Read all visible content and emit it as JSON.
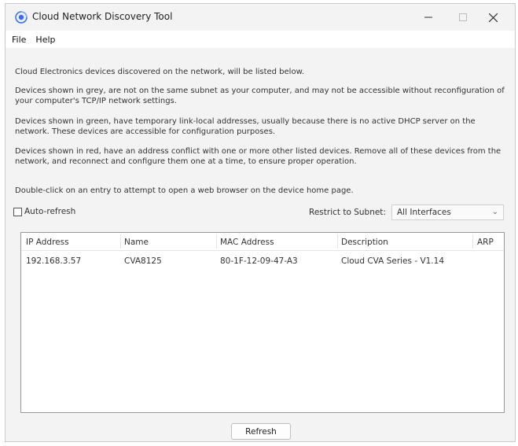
{
  "window": {
    "title": "Cloud Network Discovery Tool"
  },
  "menu": [
    "File",
    "Help"
  ],
  "instructions": [
    "Cloud Electronics devices discovered on the network, will be listed below.",
    "Devices shown in grey, are not on the same subnet as your computer, and may not be accessible without reconfiguration of your computer's TCP/IP network settings.",
    "Devices shown in green, have temporary link-local addresses, usually because there is no active DHCP server on the network. These devices are accessible for configuration purposes.",
    "Devices shown in red, have an address conflict with one or more other listed devices. Remove all of these devices from the network, and reconnect and configure them one at a time, to ensure proper operation.",
    "Double-click on an entry to attempt to open a web browser on the device home page."
  ],
  "auto_refresh": {
    "label": "Auto-refresh",
    "checked": false
  },
  "subnet": {
    "label": "Restrict to Subnet:",
    "selected": "All Interfaces"
  },
  "table": {
    "columns": [
      "IP Address",
      "Name",
      "MAC Address",
      "Description",
      "ARP"
    ],
    "rows": [
      [
        "192.168.3.57",
        "CVA8125",
        "80-1F-12-09-47-A3",
        "Cloud CVA Series - V1.14",
        ""
      ]
    ]
  },
  "refresh_label": "Refresh",
  "colors": {
    "icon_blue": "#3a6fd8",
    "window_bg": "#f3f3f3"
  }
}
